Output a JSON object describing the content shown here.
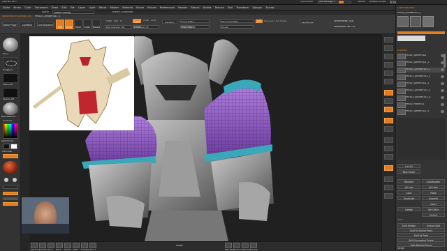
{
  "app": {
    "title": "ZBrush 4R7",
    "window_title": "ZBrush 4R7P3 — [Tool: PM3D_Cylinder3D1]",
    "quick_save": "QuickSave",
    "see_through": "See-through 0",
    "menus_label": "Menus",
    "default_script": "DefaultZScript"
  },
  "menu": {
    "items": [
      "Alpha",
      "Brush",
      "Color",
      "Document",
      "Draw",
      "Edit",
      "File",
      "Layer",
      "Light",
      "Macro",
      "Marker",
      "Material",
      "Movie",
      "Picture",
      "Preferences",
      "Render",
      "Stencil",
      "Stroke",
      "Texture",
      "Tool",
      "Transform",
      "Zplugin",
      "Zscript"
    ]
  },
  "row3": {
    "left_text": "Alpha",
    "slider_text": "Rotate Scaling",
    "right_text": "Enable Customize"
  },
  "toolbar": {
    "switch_info": "Switching to SubTool 1/4",
    "tool_name": "PM3D_Cylinder3D1_1",
    "home_page": "Home Page",
    "lightbox": "LightBox",
    "live_boolean": "Live Boolean",
    "edit": "Edit",
    "draw": "Draw",
    "move": "Move",
    "scale": "Scale",
    "rotate": "Rotate",
    "mrgb": "Mrgb",
    "rgb": "Rgb",
    "m": "M",
    "rgb_intensity": "Rgb Intensity 100",
    "zadd": "Zadd",
    "zsub": "Zsub",
    "zcut": "Zcut",
    "z_intensity": "Z Intensity 25",
    "focal_shift": "Focal Shift 0",
    "draw_size": "Draw Size 64",
    "dynamic": "Dynamic",
    "active_points": "ActivePoints: 346",
    "total_points": "TotalPoints: 98.735",
    "mirror_weld": "Mirror And Weld",
    "del_lower": "Del Lower",
    "del_higher": "Del Higher",
    "divide": "Divide",
    "smt": "Smt",
    "lazymouse": "LazyMouse"
  },
  "leftshelf": {
    "brush_label": "Move",
    "stroke_label": "DragRect",
    "alpha_label": "Alpha Off",
    "texture_label": "Texture Off",
    "material_label": "BasicMaterial",
    "gradient": "Gradient",
    "switch_color": "SwitchColor",
    "alternate": "Alternate"
  },
  "rightpanel": {
    "header": "Lightbox▸Tools",
    "tool_name": "PM3D_Cylinder3D1_1",
    "subtool_header": "Subtool",
    "subtools": [
      {
        "name": "PM3D_Sphere3D1"
      },
      {
        "name": "PM3D_Sphere3D1_1"
      },
      {
        "name": "PM3D_Cylinder3D1_1"
      },
      {
        "name": "PM3D_Cylinder3D1_2"
      },
      {
        "name": "PM3D_Sphere3D1_2"
      },
      {
        "name": "PM3D_Cylinder3D1_3"
      },
      {
        "name": "PM3D_Cylinder3D1_4"
      },
      {
        "name": "PM3D_Plane3D1"
      },
      {
        "name": "PM3D_Sphere3D1_3"
      }
    ],
    "list_all": "List All",
    "new_folder": "New Folder",
    "rename": "Rename",
    "autoreorder": "AutoReorder",
    "all_low": "All Low",
    "all_high": "All High",
    "copy": "Copy",
    "paste": "Paste",
    "duplicate": "Duplicate",
    "append": "Append",
    "insert": "Insert",
    "delete": "Delete",
    "del_other": "Del Other",
    "del_all": "Del All",
    "split": "Split",
    "split_hidden": "Split Hidden",
    "groups_split": "Groups Split",
    "split_to_similar": "Split To Similar Parts",
    "split_to_parts": "Split To Parts",
    "split_unmasked": "Split Unmasked Points",
    "split_masked": "Split Masked Points",
    "merge": "Merge",
    "boolean": "Boolean",
    "remesh": "Remesh",
    "project": "Project"
  },
  "bottombar": {
    "left_items": [
      "Standard",
      "ClayTub",
      "Pinch",
      "Move",
      "hPolish",
      "Inflat",
      "DamStd",
      "Orb_Cl"
    ],
    "center": "Morph",
    "right_items": [
      "ZModeler",
      "TrimDyn",
      "ZRemesh",
      "ShowAll"
    ]
  },
  "colors": {
    "accent": "#e37d20",
    "mesh_purple": "#8a4fc2",
    "mesh_teal": "#3aa8b8",
    "clay_gray": "#9a9a9a"
  }
}
